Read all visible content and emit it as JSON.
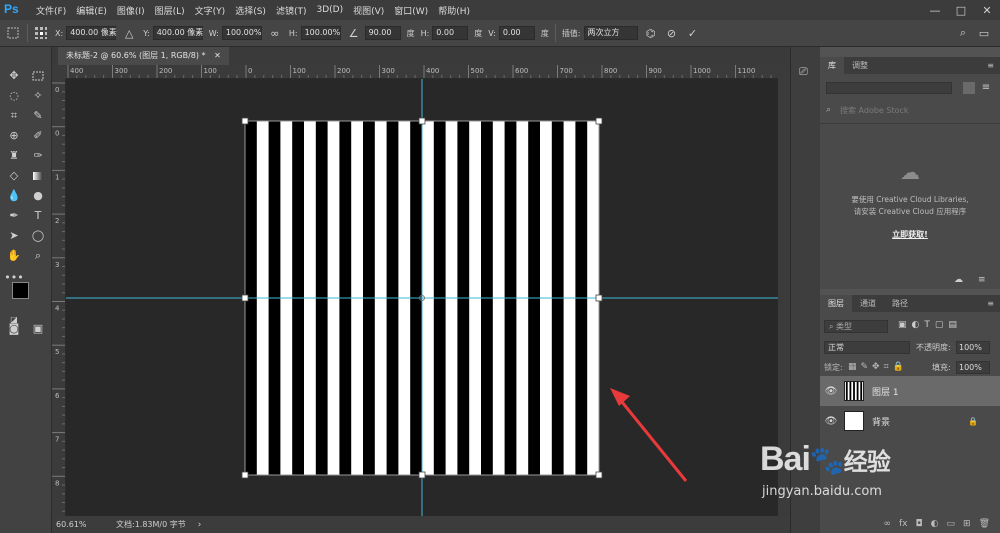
{
  "app": {
    "logo": "Ps"
  },
  "menu": [
    "文件(F)",
    "编辑(E)",
    "图像(I)",
    "图层(L)",
    "文字(Y)",
    "选择(S)",
    "滤镜(T)",
    "3D(D)",
    "视图(V)",
    "窗口(W)",
    "帮助(H)"
  ],
  "window_controls": [
    "—",
    "□",
    "✕"
  ],
  "options": {
    "x_label": "X:",
    "x_value": "400.00 像素",
    "y_label": "Y:",
    "y_value": "400.00 像素",
    "w_label": "W:",
    "w_value": "100.00%",
    "h_label": "H:",
    "h_value": "100.00%",
    "angle_value": "90.00",
    "angle_unit": "度",
    "hskew_label": "H:",
    "hskew_value": "0.00",
    "hskew_unit": "度",
    "vskew_label": "V:",
    "vskew_value": "0.00",
    "vskew_unit": "度",
    "interp_label": "插值:",
    "interp_value": "两次立方"
  },
  "document": {
    "tab_title": "未标题-2 @ 60.6% (图层 1, RGB/8) *",
    "close": "✕",
    "ruler_h_ticks": [
      "400",
      "300",
      "200",
      "100",
      "0",
      "100",
      "200",
      "300",
      "400",
      "500",
      "600",
      "700",
      "800",
      "900",
      "1000",
      "1100"
    ],
    "ruler_v_ticks": [
      "0",
      "0",
      "1",
      "2",
      "3",
      "4",
      "5",
      "6",
      "7",
      "8"
    ],
    "stripe_count": 15,
    "stripe_colors": {
      "black": "#000000",
      "white": "#ffffff"
    }
  },
  "status": {
    "zoom": "60.61%",
    "info": "文档:1.83M/0 字节",
    "arrow": "›"
  },
  "library_panel": {
    "tabs": [
      "库",
      "调整"
    ],
    "search_placeholder": "搜索 Adobe Stock",
    "message_line1": "要使用 Creative Cloud Libraries,",
    "message_line2": "请安装 Creative Cloud 应用程序",
    "link": "立即获取!"
  },
  "layers_panel": {
    "tabs": [
      "图层",
      "通道",
      "路径"
    ],
    "filter_label": "类型",
    "blend_mode": "正常",
    "opacity_label": "不透明度:",
    "opacity_value": "100%",
    "lock_label": "锁定:",
    "fill_label": "填充:",
    "fill_value": "100%",
    "layers": [
      {
        "name": "图层 1"
      },
      {
        "name": "背景"
      }
    ]
  },
  "watermark": {
    "brand": "Bai",
    "brand2": "经验",
    "url": "jingyan.baidu.com"
  },
  "colors": {
    "guide": "#3fb7d6",
    "arrow": "#e83a3a",
    "selected_layer": "#6a6a6a"
  }
}
